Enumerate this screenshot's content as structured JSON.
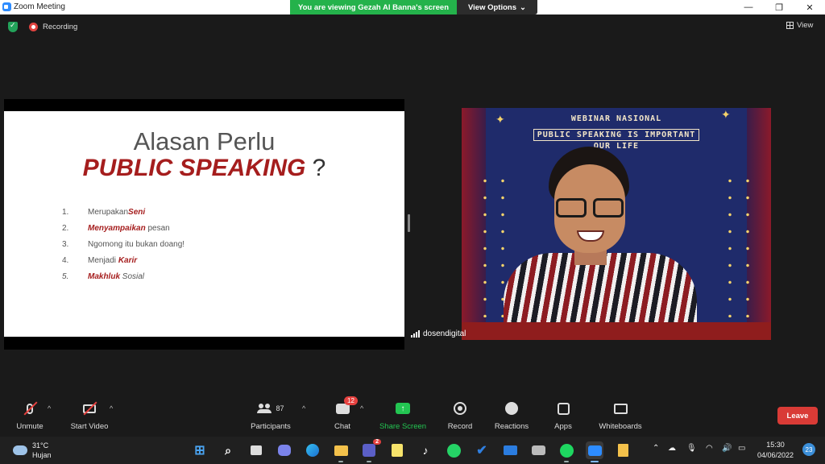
{
  "window": {
    "title": "Zoom Meeting"
  },
  "share_banner": {
    "text": "You are viewing Gezah Al Banna's screen",
    "view_options": "View Options"
  },
  "status": {
    "recording_label": "Recording",
    "view_label": "View"
  },
  "slide": {
    "title": "Alasan Perlu",
    "subtitle_accent": "PUBLIC SPEAKING",
    "subtitle_suffix": " ?",
    "items": [
      {
        "num": "1.",
        "text": "Merupakan ",
        "highlight": "Seni",
        "after": ""
      },
      {
        "num": "2.",
        "text": "",
        "highlight": "Menyampaikan",
        "after": " pesan"
      },
      {
        "num": "3.",
        "text": "Ngomong itu bukan doang!",
        "highlight": "",
        "after": ""
      },
      {
        "num": "4.",
        "text": "Menjadi ",
        "highlight": "Karir",
        "after": ""
      },
      {
        "num": "5.",
        "text": "",
        "highlight": "Makhluk",
        "after": " Sosial"
      }
    ]
  },
  "video": {
    "banner_line1": "WEBINAR NASIONAL",
    "banner_line2": "PUBLIC SPEAKING IS IMPORTANT",
    "banner_line3": "OUR LIFE",
    "participant_name": "dosendigital"
  },
  "toolbar": {
    "unmute": "Unmute",
    "start_video": "Start Video",
    "participants": "Participants",
    "participants_count": "87",
    "chat": "Chat",
    "chat_badge": "12",
    "share_screen": "Share Screen",
    "record": "Record",
    "reactions": "Reactions",
    "apps": "Apps",
    "whiteboards": "Whiteboards",
    "leave": "Leave"
  },
  "taskbar": {
    "temperature": "31°C",
    "weather": "Hujan",
    "teams_badge": "2",
    "time": "15:30",
    "date": "04/06/2022",
    "notifications": "23"
  },
  "colors": {
    "accent_red": "#a51d1d",
    "zoom_green": "#24b24b",
    "leave_red": "#d93b36"
  }
}
